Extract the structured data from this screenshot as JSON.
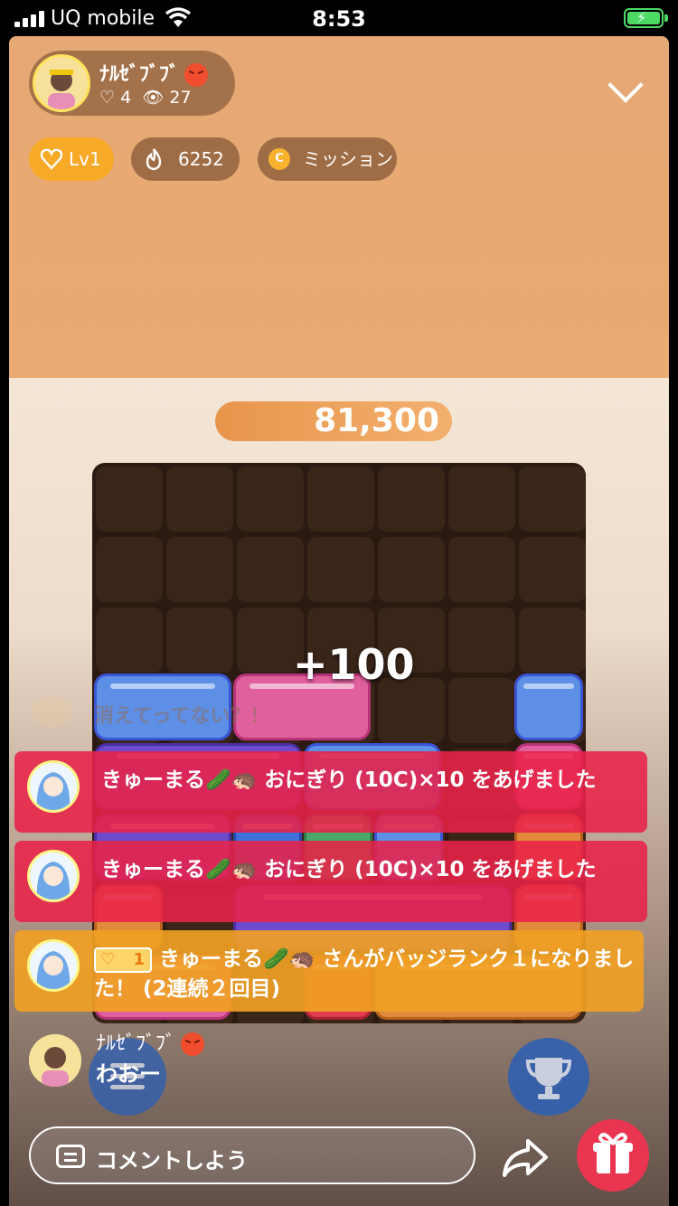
{
  "status_bar": {
    "carrier": "UQ mobile",
    "time": "8:53"
  },
  "host": {
    "name": "ﾅﾙｾﾞﾌﾞﾌﾞ",
    "likes": "4",
    "viewers": "27"
  },
  "chips": {
    "level": "Lv1",
    "flame": "6252",
    "mission": "ミッション",
    "coin_letter": "C"
  },
  "score": "81,300",
  "board": {
    "gain": "+100"
  },
  "chat": {
    "ghost": "消えてってない？！",
    "gifts": [
      {
        "text": "きゅーまる🥒🦔 おにぎり (10C)×10 をあげました"
      },
      {
        "text": "きゅーまる🥒🦔 おにぎり (10C)×10 をあげました"
      }
    ],
    "badge": {
      "rank": "1",
      "text": "きゅーまる🥒🦔 さんがバッジランク１になりました！ (2連続２回目)"
    },
    "last": {
      "name": "ﾅﾙｾﾞﾌﾞﾌﾞ",
      "text": "わおー"
    }
  },
  "comment": {
    "placeholder": "コメントしよう"
  },
  "colors": {
    "accent_red": "#ea3550",
    "gift_card": "#e82248",
    "badge_card": "#f0a024",
    "level_chip": "#f7a928"
  },
  "icons": [
    "heart-icon",
    "eye-icon",
    "flame-icon",
    "coin-icon",
    "chevron-down-icon",
    "comment-icon",
    "share-icon",
    "gift-icon",
    "trophy-icon",
    "menu-icon"
  ]
}
